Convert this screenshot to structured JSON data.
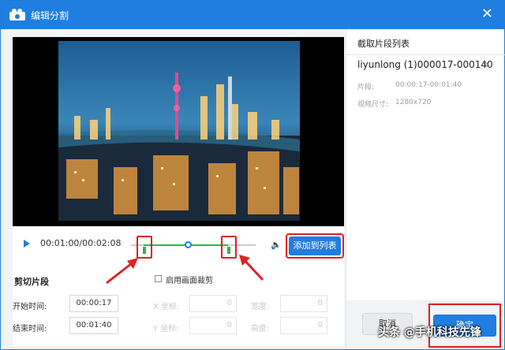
{
  "window": {
    "title": "编辑分割",
    "close_symbol": "✕"
  },
  "player": {
    "time_display": "00:01:00/00:02:08",
    "add_button_label": "添加到列表",
    "volume_symbol": "🔈"
  },
  "clip_form": {
    "section_title": "剪切片段",
    "start_label": "开始时间:",
    "start_value": "00:00:17",
    "end_label": "结束时间:",
    "end_value": "00:01:40"
  },
  "crop": {
    "enable_label": "启用画面裁剪",
    "x_label": "X 坐标:",
    "x_value": "0",
    "width_label": "宽度:",
    "width_value": "0",
    "y_label": "Y 坐标:",
    "y_value": "0",
    "height_label": "高度:",
    "height_value": "0"
  },
  "clip_list": {
    "title": "截取片段列表",
    "clip_name": "liyunlong (1)000017-000140",
    "segment_label": "片段:",
    "segment_value": "00:00:17-00:01:40",
    "size_label": "视频尺寸:",
    "size_value": "1280x720"
  },
  "footer": {
    "cancel_label": "取消",
    "ok_label": "确定"
  },
  "watermark": "头条 @手机科技先锋",
  "colors": {
    "accent": "#1f7ee0",
    "highlight": "#e02020",
    "selection": "#2fb64a"
  }
}
